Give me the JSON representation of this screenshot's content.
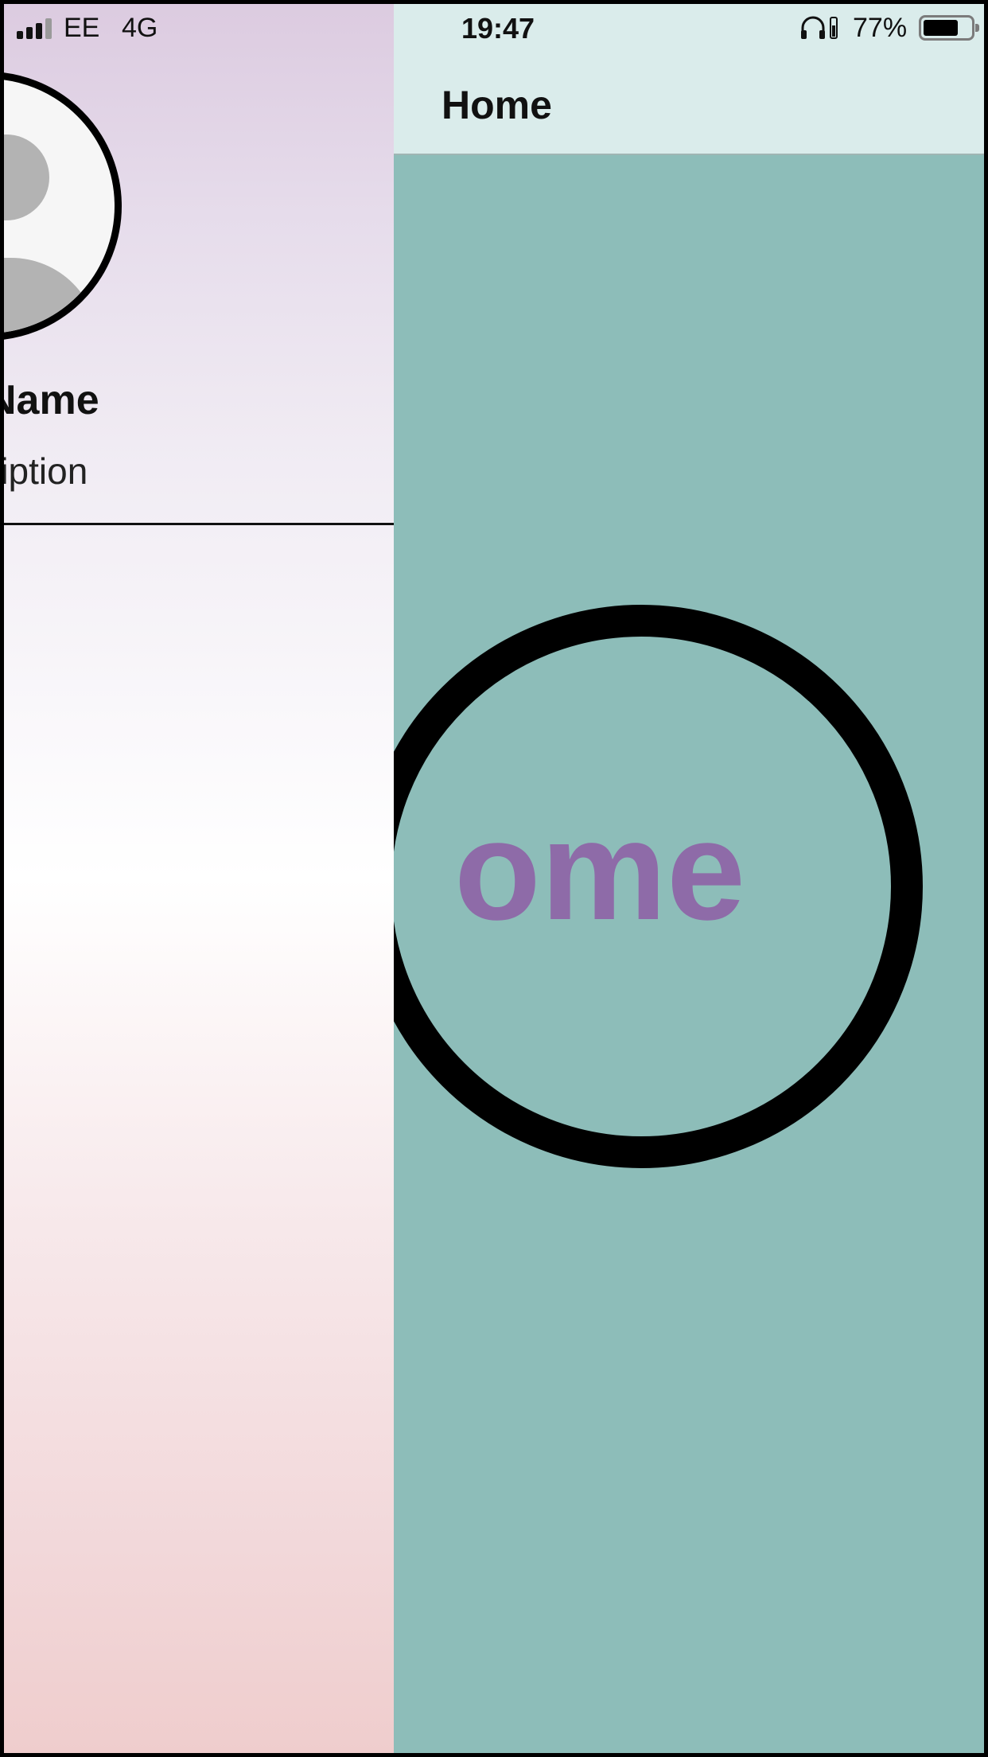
{
  "status_bar": {
    "carrier": "EE",
    "network": "4G",
    "time": "19:47",
    "battery_percent": "77%",
    "battery_level": 0.77,
    "icons": [
      "signal-bars-icon",
      "headphones-icon",
      "headphones-battery-icon",
      "battery-icon"
    ]
  },
  "drawer": {
    "profile_name": "Name",
    "profile_description": "scription",
    "avatar_icon": "person-placeholder-icon",
    "gradient_colors": [
      "#dccbe0",
      "#ffffff",
      "#efcdcd"
    ]
  },
  "nav": {
    "title": "Home"
  },
  "main": {
    "center_text": "ome",
    "center_text_color": "#8e6ba8",
    "background_color": "#8dbdb9",
    "nav_background_color": "#daeceb"
  }
}
